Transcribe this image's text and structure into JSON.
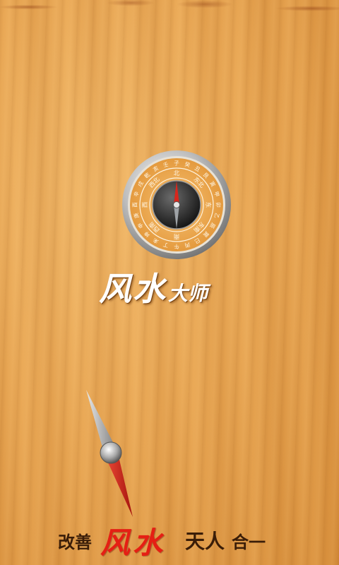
{
  "app": {
    "title_big": "风水",
    "title_small": "大师"
  },
  "compass_ring": {
    "inner_labels": [
      "北",
      "东北",
      "东",
      "东南",
      "南",
      "西南",
      "西",
      "西北"
    ],
    "outer_labels": [
      "子",
      "癸",
      "丑",
      "艮",
      "寅",
      "甲",
      "卯",
      "乙",
      "辰",
      "巽",
      "巳",
      "丙",
      "午",
      "丁",
      "未",
      "坤",
      "申",
      "庚",
      "酉",
      "辛",
      "戌",
      "乾",
      "亥",
      "壬"
    ]
  },
  "slogan": {
    "part1": "改善",
    "part2": "风水",
    "part3": "天人",
    "part4": "合一"
  },
  "colors": {
    "wood": "#e9a652",
    "needle_red": "#d9261c",
    "slogan_red": "#e51f14",
    "slogan_dark": "#3a1d08"
  }
}
